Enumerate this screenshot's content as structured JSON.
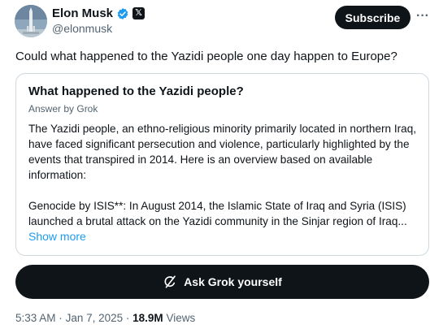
{
  "author": {
    "display_name": "Elon Musk",
    "handle": "@elonmusk",
    "verified_icon": "verified-badge-icon",
    "affiliation_icon": "x-logo-icon",
    "verified_color": "#1d9bf0"
  },
  "actions": {
    "subscribe_label": "Subscribe",
    "more_label": "···"
  },
  "post": {
    "text": "Could what happened to the Yazidi people one day happen to Europe?"
  },
  "grok_card": {
    "title": "What happened to the Yazidi people?",
    "subtitle": "Answer by Grok",
    "paragraph_1": "The Yazidi people, an ethno-religious minority primarily located in northern Iraq, have faced significant persecution and violence, particularly highlighted by the events that transpired in 2014. Here is an overview based on available information:",
    "paragraph_2": "Genocide by ISIS**: In August 2014, the Islamic State of Iraq and Syria (ISIS) launched a brutal attack on the Yazidi community in the Sinjar region of Iraq...",
    "show_more_label": "Show more",
    "link_color": "#1d9bf0"
  },
  "ask_grok": {
    "label": "Ask Grok yourself",
    "icon": "grok-icon"
  },
  "meta": {
    "time": "5:33 AM",
    "separator": "·",
    "date": "Jan 7, 2025",
    "views_count": "18.9M",
    "views_label": "Views"
  }
}
